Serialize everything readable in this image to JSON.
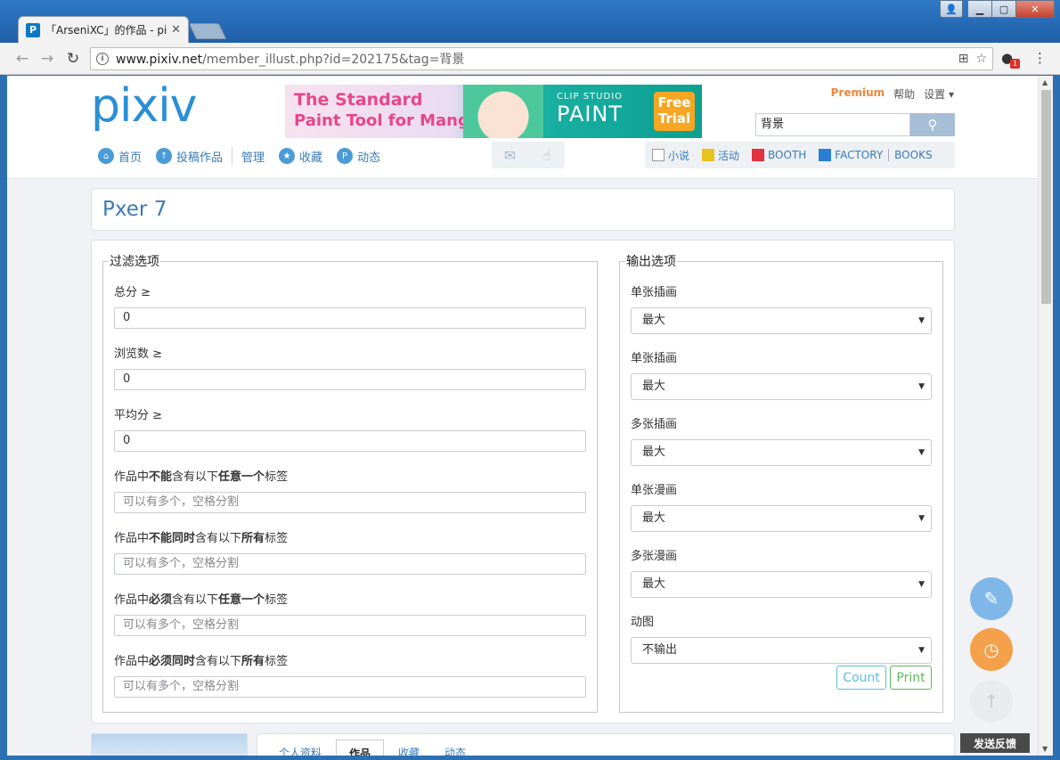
{
  "browser": {
    "tab_title": "「ArseniXC」的作品 - pixiv",
    "tab_favicon": "P",
    "url_host": "www.pixiv.net",
    "url_path": "/member_illust.php?id=202175&tag=背景",
    "window_user_icon": "user-icon",
    "ext_badge": "1"
  },
  "header": {
    "logo": "pixiv",
    "banner": {
      "line1": "The Standard",
      "line2": "Paint Tool for Manga",
      "brand_small": "CLIP STUDIO",
      "brand_big": "PAINT",
      "trial": "Free Trial"
    },
    "top_links": {
      "premium": "Premium",
      "help": "帮助",
      "settings": "设置 ▾"
    },
    "search": {
      "value": "背景"
    },
    "nav": [
      {
        "label": "首页",
        "icon": "home-icon"
      },
      {
        "label": "投稿作品",
        "icon": "upload-icon"
      },
      {
        "label": "管理"
      },
      {
        "label": "收藏",
        "icon": "star-icon"
      },
      {
        "label": "动态",
        "icon": "feed-icon"
      }
    ],
    "right_nav": {
      "novel": "小说",
      "event": "活动",
      "booth": "BOOTH",
      "factory": "FACTORY",
      "books": "BOOKS"
    }
  },
  "pxer": {
    "title": "Pxer 7",
    "filter": {
      "legend": "过滤选项",
      "score_label": "总分 ≥",
      "score_value": "0",
      "views_label": "浏览数 ≥",
      "views_value": "0",
      "avg_label": "平均分 ≥",
      "avg_value": "0",
      "tag_placeholder": "可以有多个，空格分割",
      "rule1": {
        "a": "作品中",
        "b": "不能",
        "c": "含有以下",
        "d": "任意一个",
        "e": "标签"
      },
      "rule2": {
        "a": "作品中",
        "b": "不能同时",
        "c": "含有以下",
        "d": "所有",
        "e": "标签"
      },
      "rule3": {
        "a": "作品中",
        "b": "必须",
        "c": "含有以下",
        "d": "任意一个",
        "e": "标签"
      },
      "rule4": {
        "a": "作品中",
        "b": "必须同时",
        "c": "含有以下",
        "d": "所有",
        "e": "标签"
      }
    },
    "output": {
      "legend": "输出选项",
      "selects": [
        {
          "label": "单张插画",
          "value": "最大"
        },
        {
          "label": "单张插画",
          "value": "最大"
        },
        {
          "label": "多张插画",
          "value": "最大"
        },
        {
          "label": "单张漫画",
          "value": "最大"
        },
        {
          "label": "多张漫画",
          "value": "最大"
        },
        {
          "label": "动图",
          "value": "不输出"
        }
      ],
      "count_label": "Count",
      "print_label": "Print"
    }
  },
  "profile_tabs": [
    "个人资料",
    "作品",
    "收藏",
    "动态"
  ],
  "feedback": "发送反馈",
  "colors": {
    "accent": "#3a7bb8",
    "premium": "#f0863a",
    "count": "#5bc0de",
    "print": "#5cb85c"
  }
}
